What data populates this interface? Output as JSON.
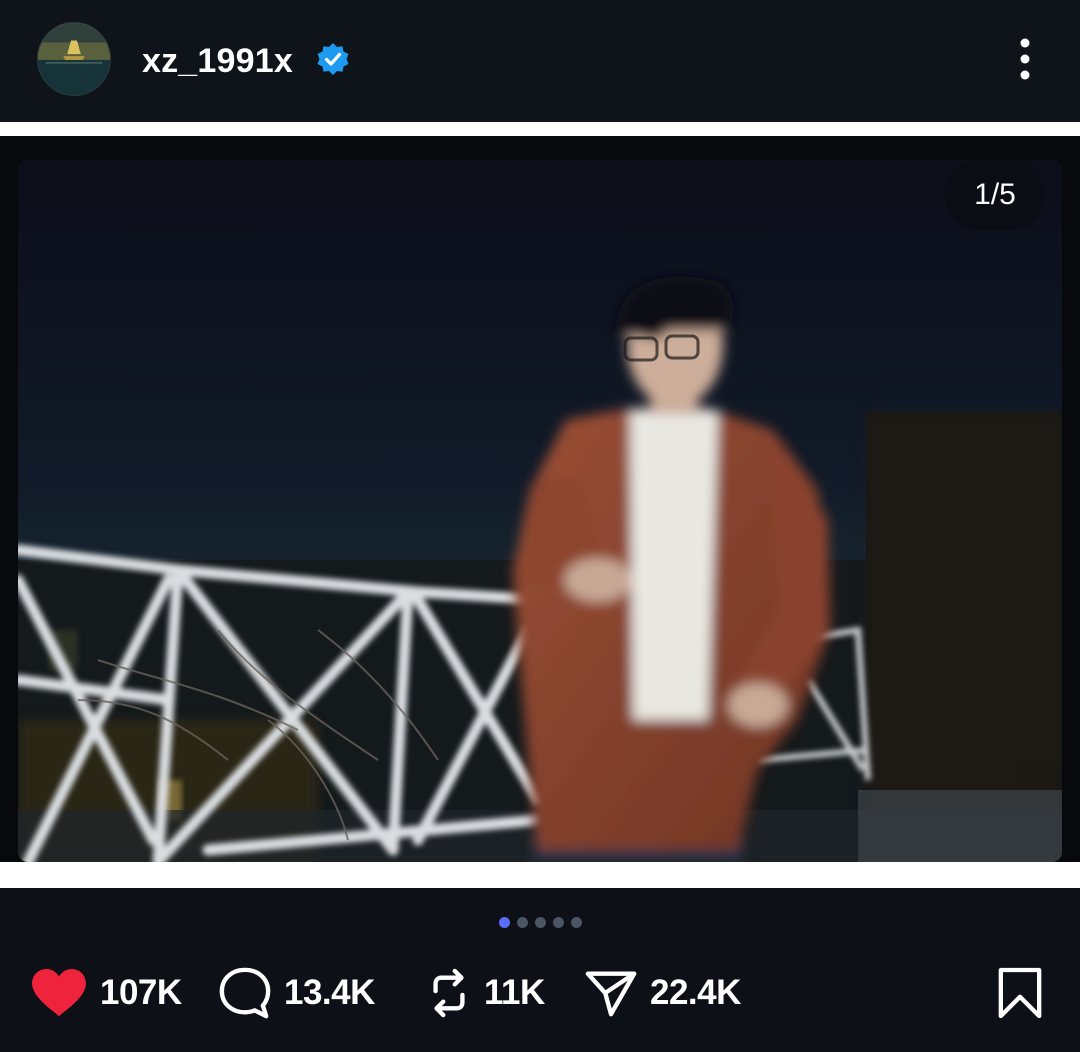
{
  "post": {
    "username": "xz_1991x",
    "verified": true,
    "counter": "1/5"
  },
  "carousel": {
    "total": 5,
    "active_index": 0
  },
  "actions": {
    "likes": "107K",
    "comments": "13.4K",
    "reposts": "11K",
    "shares": "22.4K"
  },
  "colors": {
    "background": "#0d1117",
    "verified_badge": "#1d9bf0",
    "like_heart": "#ef233c",
    "active_dot": "#5b6cf6"
  },
  "icons": {
    "avatar": "avatar-image",
    "verified": "verified-badge-icon",
    "more": "more-vertical-icon",
    "like": "heart-icon",
    "comment": "comment-bubble-icon",
    "repost": "repost-icon",
    "share": "share-icon",
    "save": "bookmark-icon"
  }
}
